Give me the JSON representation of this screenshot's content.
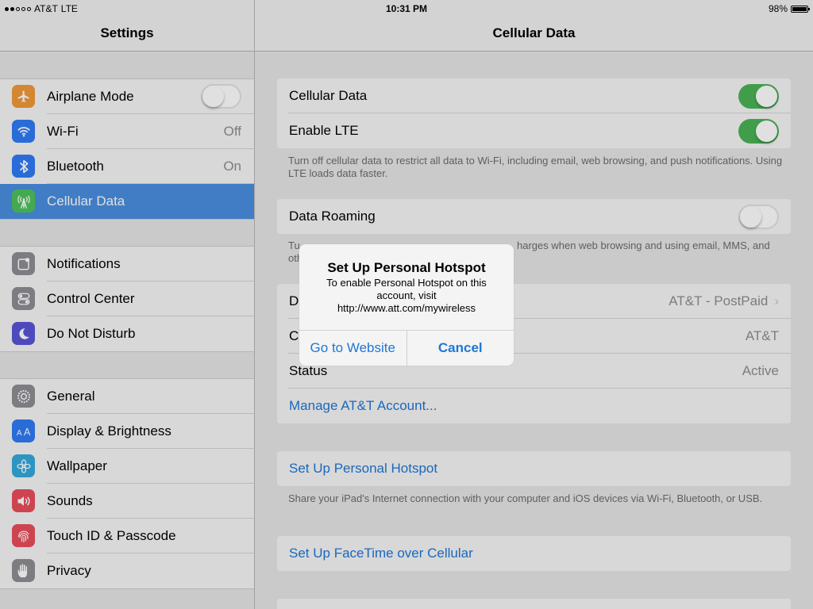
{
  "status_bar": {
    "carrier": "AT&T",
    "network": "LTE",
    "time": "10:31 PM",
    "battery": "98%",
    "battery_level": 0.98,
    "signal_bars": 2
  },
  "sidebar": {
    "title": "Settings",
    "groups": [
      [
        {
          "label": "Airplane Mode",
          "icon": "airplane-icon",
          "icon_color": "#f19a38",
          "accessory": "switch",
          "switch_on": false
        },
        {
          "label": "Wi-Fi",
          "icon": "wifi-icon",
          "icon_color": "#2f7cf6",
          "value": "Off"
        },
        {
          "label": "Bluetooth",
          "icon": "bluetooth-icon",
          "icon_color": "#2f7cf6",
          "value": "On"
        },
        {
          "label": "Cellular Data",
          "icon": "cellular-icon",
          "icon_color": "#4cc35a",
          "selected": true
        }
      ],
      [
        {
          "label": "Notifications",
          "icon": "notifications-icon",
          "icon_color": "#8e8e93"
        },
        {
          "label": "Control Center",
          "icon": "control-center-icon",
          "icon_color": "#8e8e93"
        },
        {
          "label": "Do Not Disturb",
          "icon": "moon-icon",
          "icon_color": "#5856d6"
        }
      ],
      [
        {
          "label": "General",
          "icon": "gear-icon",
          "icon_color": "#8e8e93"
        },
        {
          "label": "Display & Brightness",
          "icon": "display-icon",
          "icon_color": "#2f7cf6"
        },
        {
          "label": "Wallpaper",
          "icon": "wallpaper-icon",
          "icon_color": "#34aadc"
        },
        {
          "label": "Sounds",
          "icon": "speaker-icon",
          "icon_color": "#ea4e5c"
        },
        {
          "label": "Touch ID & Passcode",
          "icon": "fingerprint-icon",
          "icon_color": "#ea4e5c"
        },
        {
          "label": "Privacy",
          "icon": "hand-icon",
          "icon_color": "#8e8e93"
        }
      ]
    ]
  },
  "detail": {
    "title": "Cellular Data",
    "cellular_group": [
      {
        "label": "Cellular Data",
        "switch_on": true
      },
      {
        "label": "Enable LTE",
        "switch_on": true
      }
    ],
    "cellular_note": "Turn off cellular data to restrict all data to Wi-Fi, including email, web browsing, and push notifications. Using LTE loads data faster.",
    "roaming": {
      "label": "Data Roaming",
      "switch_on": false
    },
    "roaming_note_left": "Tu",
    "roaming_note_left2": "oth",
    "roaming_note_right": "harges when web browsing and using email, MMS, and",
    "account_group": {
      "plan_label": "Da",
      "plan_value": "AT&T - PostPaid",
      "carrier_label": "Ca",
      "carrier_value": "AT&T",
      "status_label": "Status",
      "status_value": "Active",
      "manage_link": "Manage AT&T Account..."
    },
    "hotspot_link": "Set Up Personal Hotspot",
    "hotspot_note": "Share your iPad's Internet connection with your computer and iOS devices via Wi-Fi, Bluetooth, or USB.",
    "facetime_link": "Set Up FaceTime over Cellular"
  },
  "alert": {
    "title": "Set Up Personal Hotspot",
    "message": "To enable Personal Hotspot on this account, visit http://www.att.com/mywireless",
    "buttons": [
      "Go to Website",
      "Cancel"
    ]
  },
  "colors": {
    "accent": "#1e77d6",
    "selected": "#4a8fe0",
    "switch_on": "#4cb356"
  }
}
